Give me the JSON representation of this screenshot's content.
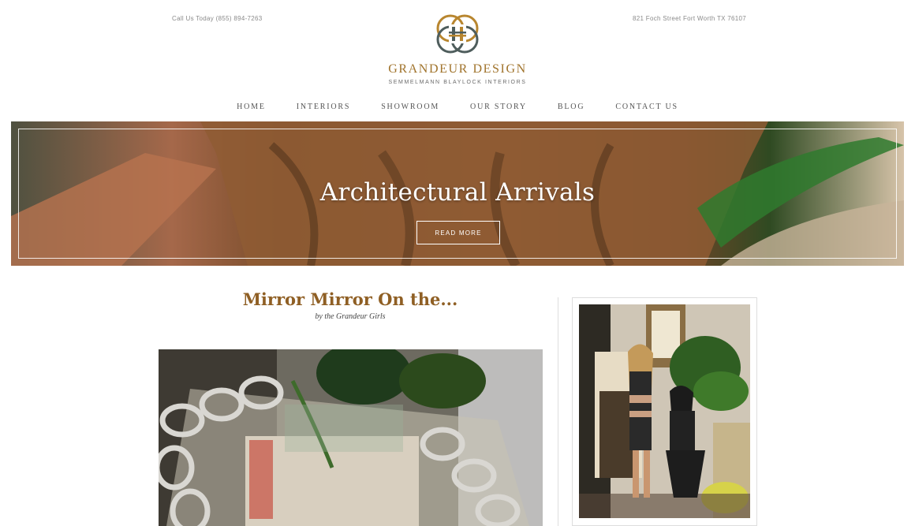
{
  "header": {
    "phone": "Call Us Today (855) 894-7263",
    "address": "821 Foch Street Fort Worth TX 76107",
    "brand_name": "GRANDEUR DESIGN",
    "tagline": "SEMMELMANN BLAYLOCK INTERIORS"
  },
  "nav": {
    "items": [
      {
        "label": "HOME"
      },
      {
        "label": "INTERIORS"
      },
      {
        "label": "SHOWROOM"
      },
      {
        "label": "OUR STORY"
      },
      {
        "label": "BLOG"
      },
      {
        "label": "CONTACT US"
      }
    ]
  },
  "hero": {
    "title": "Architectural Arrivals",
    "button_label": "READ MORE"
  },
  "post": {
    "title": "Mirror Mirror On the...",
    "byline": "by the Grandeur Girls"
  },
  "colors": {
    "brand_gold": "#a0732b",
    "post_title": "#8f5f24",
    "logo_gold": "#b8862f",
    "logo_slate": "#4e5d5c"
  }
}
